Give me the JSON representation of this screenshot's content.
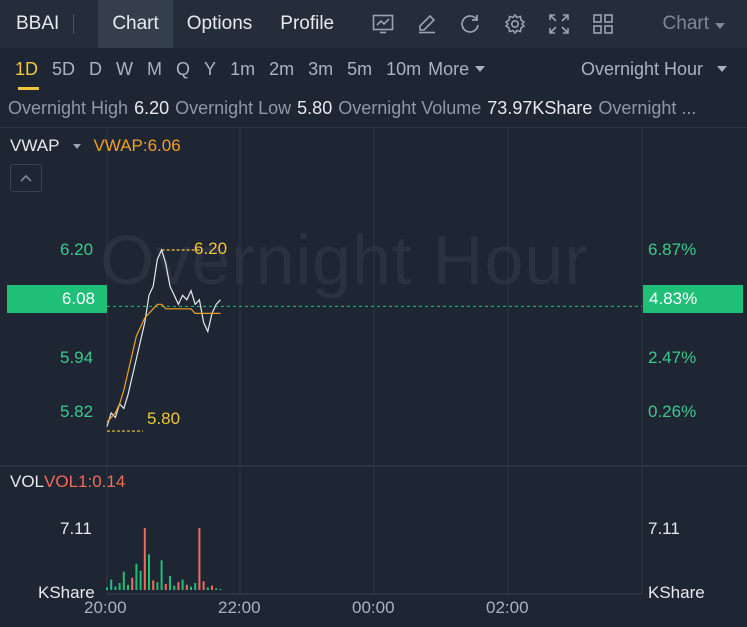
{
  "header": {
    "ticker": "BBAI",
    "tabs": [
      "Chart",
      "Options",
      "Profile"
    ],
    "active_tab": "Chart",
    "tool_icons": [
      "indicator-chart-icon",
      "draw-pen-icon",
      "refresh-icon",
      "settings-gear-icon",
      "fullscreen-expand-icon",
      "layout-grid-icon"
    ],
    "chart_type_label": "Chart"
  },
  "periods": {
    "items": [
      "1D",
      "5D",
      "D",
      "W",
      "M",
      "Q",
      "Y",
      "1m",
      "2m",
      "3m",
      "5m",
      "10m"
    ],
    "active": "1D",
    "more_label": "More",
    "session_label": "Overnight Hour"
  },
  "stats": [
    {
      "label": "Overnight High",
      "value": "6.20"
    },
    {
      "label": "Overnight Low",
      "value": "5.80"
    },
    {
      "label": "Overnight Volume",
      "value": "73.97KShare"
    },
    {
      "label": "Overnight ...",
      "value": ""
    }
  ],
  "price_panel": {
    "indicator": "VWAP",
    "indicator_value": "VWAP:6.06",
    "watermark": "Overnight Hour",
    "left_ticks": [
      "6.20",
      "5.94",
      "5.82"
    ],
    "right_ticks": [
      "6.87%",
      "2.47%",
      "0.26%"
    ],
    "last_price": "6.08",
    "last_pct": "4.83%",
    "high_label": "6.20",
    "low_label": "5.80"
  },
  "volume_panel": {
    "indicator": "VOL",
    "indicator_value": "VOL1:0.14",
    "left_tick": "7.11",
    "right_tick": "7.11",
    "unit_left": "KShare",
    "unit_right": "KShare"
  },
  "x_axis": [
    "20:00",
    "22:00",
    "00:00",
    "02:00"
  ],
  "colors": {
    "up": "#1fbf78",
    "down": "#f26b5b",
    "accent": "#f0c63b",
    "vwap": "#f0a020",
    "price_line": "#e6e9ee"
  },
  "chart_data": {
    "type": "line",
    "y_range": [
      5.76,
      6.28
    ],
    "price_series": [
      [
        0,
        5.81
      ],
      [
        1,
        5.84
      ],
      [
        2,
        5.83
      ],
      [
        3,
        5.86
      ],
      [
        4,
        5.85
      ],
      [
        5,
        5.88
      ],
      [
        6,
        5.92
      ],
      [
        7,
        5.96
      ],
      [
        8,
        6.0
      ],
      [
        9,
        6.04
      ],
      [
        10,
        6.1
      ],
      [
        11,
        6.12
      ],
      [
        12,
        6.18
      ],
      [
        13,
        6.2
      ],
      [
        14,
        6.17
      ],
      [
        15,
        6.12
      ],
      [
        16,
        6.1
      ],
      [
        17,
        6.08
      ],
      [
        18,
        6.1
      ],
      [
        19,
        6.09
      ],
      [
        20,
        6.11
      ],
      [
        21,
        6.08
      ],
      [
        22,
        6.09
      ],
      [
        23,
        6.04
      ],
      [
        24,
        6.02
      ],
      [
        25,
        6.06
      ],
      [
        26,
        6.08
      ],
      [
        27,
        6.09
      ]
    ],
    "vwap_series": [
      [
        0,
        5.82
      ],
      [
        1,
        5.83
      ],
      [
        2,
        5.84
      ],
      [
        3,
        5.86
      ],
      [
        4,
        5.89
      ],
      [
        5,
        5.93
      ],
      [
        6,
        5.97
      ],
      [
        7,
        6.01
      ],
      [
        8,
        6.03
      ],
      [
        9,
        6.05
      ],
      [
        10,
        6.06
      ],
      [
        11,
        6.07
      ],
      [
        12,
        6.08
      ],
      [
        13,
        6.08
      ],
      [
        14,
        6.07
      ],
      [
        15,
        6.07
      ],
      [
        16,
        6.07
      ],
      [
        17,
        6.07
      ],
      [
        18,
        6.07
      ],
      [
        19,
        6.07
      ],
      [
        20,
        6.07
      ],
      [
        21,
        6.06
      ],
      [
        22,
        6.06
      ],
      [
        23,
        6.06
      ],
      [
        24,
        6.06
      ],
      [
        25,
        6.06
      ],
      [
        26,
        6.06
      ],
      [
        27,
        6.06
      ]
    ],
    "volume": [
      0.3,
      1.2,
      0.4,
      0.8,
      2.1,
      0.6,
      1.4,
      3.0,
      2.2,
      7.11,
      4.1,
      1.1,
      0.9,
      3.4,
      0.7,
      1.6,
      0.5,
      0.9,
      1.2,
      0.6,
      0.4,
      0.8,
      7.11,
      1.0,
      0.3,
      0.5,
      0.2,
      0.1
    ],
    "volume_up": [
      true,
      true,
      true,
      true,
      true,
      true,
      false,
      true,
      true,
      false,
      true,
      false,
      true,
      true,
      false,
      true,
      true,
      false,
      true,
      false,
      true,
      true,
      false,
      false,
      true,
      false,
      true,
      true
    ]
  }
}
